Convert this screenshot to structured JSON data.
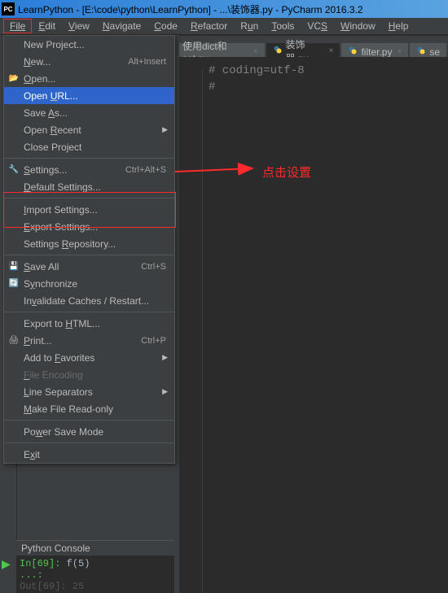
{
  "title": "LearnPython - [E:\\code\\python\\LearnPython] - ...\\装饰器.py - PyCharm 2016.3.2",
  "logo_text": "PC",
  "menubar": [
    "File",
    "Edit",
    "View",
    "Navigate",
    "Code",
    "Refactor",
    "Run",
    "Tools",
    "VCS",
    "Window",
    "Help"
  ],
  "dropdown": {
    "groups": [
      [
        {
          "label": "New Project...",
          "shortcut": "",
          "icon": "",
          "submenu": false
        },
        {
          "label": "New...",
          "shortcut": "Alt+Insert",
          "icon": "",
          "submenu": false
        },
        {
          "label": "Open...",
          "shortcut": "",
          "icon": "folder-open-icon",
          "submenu": false
        },
        {
          "label": "Open URL...",
          "shortcut": "",
          "icon": "",
          "submenu": false,
          "highlight": true
        },
        {
          "label": "Save As...",
          "shortcut": "",
          "icon": "",
          "submenu": false
        },
        {
          "label": "Open Recent",
          "shortcut": "",
          "icon": "",
          "submenu": true
        },
        {
          "label": "Close Project",
          "shortcut": "",
          "icon": "",
          "submenu": false
        }
      ],
      [
        {
          "label": "Settings...",
          "shortcut": "Ctrl+Alt+S",
          "icon": "wrench-icon",
          "submenu": false
        },
        {
          "label": "Default Settings...",
          "shortcut": "",
          "icon": "",
          "submenu": false
        }
      ],
      [
        {
          "label": "Import Settings...",
          "shortcut": "",
          "icon": "",
          "submenu": false
        },
        {
          "label": "Export Settings...",
          "shortcut": "",
          "icon": "",
          "submenu": false
        },
        {
          "label": "Settings Repository...",
          "shortcut": "",
          "icon": "",
          "submenu": false
        }
      ],
      [
        {
          "label": "Save All",
          "shortcut": "Ctrl+S",
          "icon": "save-icon",
          "submenu": false
        },
        {
          "label": "Synchronize",
          "shortcut": "",
          "icon": "sync-icon",
          "submenu": false
        },
        {
          "label": "Invalidate Caches / Restart...",
          "shortcut": "",
          "icon": "",
          "submenu": false
        }
      ],
      [
        {
          "label": "Export to HTML...",
          "shortcut": "",
          "icon": "",
          "submenu": false
        },
        {
          "label": "Print...",
          "shortcut": "Ctrl+P",
          "icon": "print-icon",
          "submenu": false
        },
        {
          "label": "Add to Favorites",
          "shortcut": "",
          "icon": "",
          "submenu": true
        },
        {
          "label": "File Encoding",
          "shortcut": "",
          "icon": "",
          "submenu": false,
          "disabled": true
        },
        {
          "label": "Line Separators",
          "shortcut": "",
          "icon": "",
          "submenu": true
        },
        {
          "label": "Make File Read-only",
          "shortcut": "",
          "icon": "",
          "submenu": false
        }
      ],
      [
        {
          "label": "Power Save Mode",
          "shortcut": "",
          "icon": "",
          "submenu": false
        }
      ],
      [
        {
          "label": "Exit",
          "shortcut": "",
          "icon": "",
          "submenu": false
        }
      ]
    ]
  },
  "tabs": [
    {
      "label": "使用dict和set.py",
      "active": false,
      "partial": true
    },
    {
      "label": "装饰器.py",
      "active": true
    },
    {
      "label": "filter.py",
      "active": false
    },
    {
      "label": "se",
      "active": false,
      "partial": true
    }
  ],
  "code_lines": [
    "# coding=utf-8",
    "#"
  ],
  "console": {
    "header": "Python Console",
    "lines": [
      {
        "prompt": "In[69]:",
        "code": " f(5)"
      },
      {
        "prompt": "   ...:",
        "code": ""
      },
      {
        "out": "Out[69]: 25",
        "dim": true
      }
    ]
  },
  "annotation_text": "点击设置"
}
